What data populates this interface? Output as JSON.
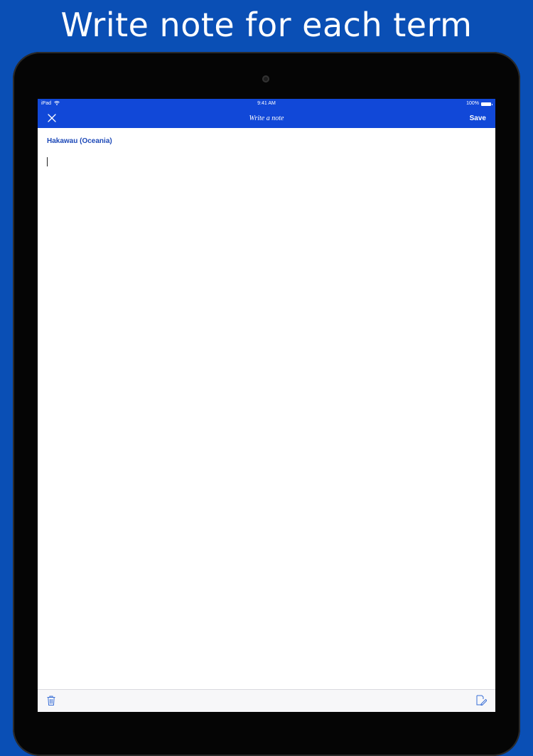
{
  "headline": "Write note for each term",
  "status_bar": {
    "carrier": "iPad",
    "time": "9:41 AM",
    "battery": "100%"
  },
  "nav": {
    "title": "Write a note",
    "save_label": "Save"
  },
  "note": {
    "term": "Hakawau (Oceania)",
    "text": ""
  },
  "colors": {
    "background": "#0a4fb5",
    "nav_bar": "#1148d8",
    "term_title": "#1d49b8",
    "toolbar_icons": "#3a6fd6"
  },
  "icons": {
    "close": "close-icon",
    "wifi": "wifi-icon",
    "battery": "battery-icon",
    "delete": "trash-icon",
    "compose": "edit-icon"
  }
}
